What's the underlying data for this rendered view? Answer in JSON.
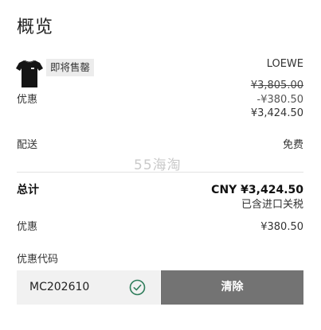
{
  "header": {
    "title": "概览"
  },
  "item": {
    "badge": "即将售罄",
    "brand": "LOEWE",
    "original_price": "¥3,805.00",
    "discount": "-¥380.50",
    "final_price": "¥3,424.50",
    "discount_label": "优惠"
  },
  "shipping": {
    "label": "配送",
    "value": "免费"
  },
  "watermark": "55海淘",
  "total": {
    "label": "总计",
    "value": "CNY ¥3,424.50",
    "note": "已含进口关税"
  },
  "summary_discount": {
    "label": "优惠",
    "value": "¥380.50"
  },
  "promo": {
    "label": "优惠代码",
    "code": "MC202610",
    "clear_label": "清除"
  },
  "colors": {
    "button_bg": "#737373",
    "input_bg": "#f1f1f1",
    "check_green": "#2f7d5b",
    "badge_bg": "#ececec"
  },
  "icons": {
    "product": "black-tshirt-thumbnail",
    "valid": "check-circle-icon"
  }
}
